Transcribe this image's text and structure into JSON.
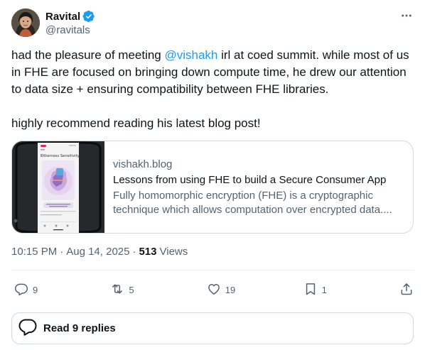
{
  "author": {
    "display_name": "Ravital",
    "handle": "@ravitals",
    "verified": true
  },
  "tweet": {
    "paragraph1_before": "had the pleasure of meeting ",
    "mention": "@vishakh",
    "paragraph1_after": " irl at coed summit. while most of us in FHE are focused on bringing down compute time, he drew our attention to data size + ensuring compatibility between FHE libraries.",
    "paragraph2": "highly recommend reading his latest blog post!"
  },
  "card": {
    "domain": "vishakh.blog",
    "title": "Lessons from using FHE to build a Secure Consumer App",
    "description": "Fully homomorphic encryption (FHE) is a cryptographic technique which allows computation over encrypted data....",
    "thumb_heading": "Bitterness Sensitivity"
  },
  "meta": {
    "time": "10:15 PM",
    "separator": "·",
    "date": "Aug 14, 2025",
    "views_count": "513",
    "views_label": "Views"
  },
  "actions": {
    "replies": "9",
    "reposts": "5",
    "likes": "19",
    "bookmarks": "1"
  },
  "read_replies_label": "Read 9 replies",
  "colors": {
    "accent": "#1d9bf0",
    "text_primary": "#0f1419",
    "text_secondary": "#536471",
    "border": "#cfd9de"
  }
}
